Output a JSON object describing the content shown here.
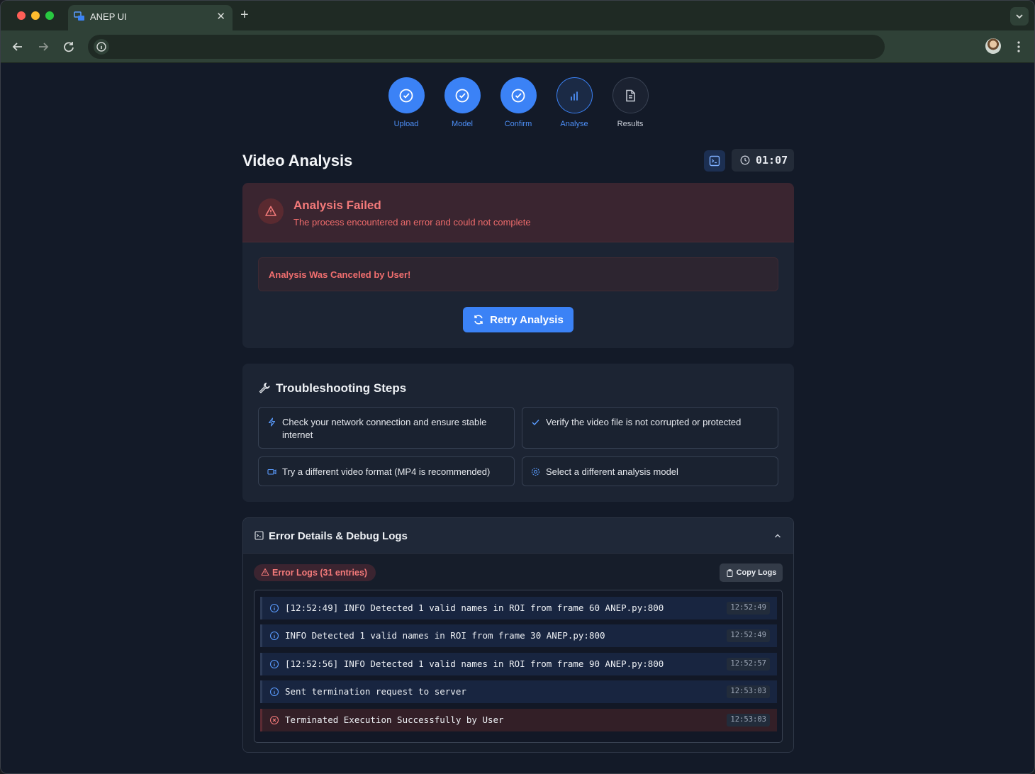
{
  "browser": {
    "tab_title": "ANEP UI",
    "tab_close": "✕",
    "new_tab": "+"
  },
  "stepper": {
    "steps": [
      {
        "label": "Upload",
        "state": "done",
        "icon": "check-circle-icon"
      },
      {
        "label": "Model",
        "state": "done",
        "icon": "check-circle-icon"
      },
      {
        "label": "Confirm",
        "state": "done",
        "icon": "check-circle-icon"
      },
      {
        "label": "Analyse",
        "state": "active",
        "icon": "bar-chart-icon"
      },
      {
        "label": "Results",
        "state": "pending",
        "icon": "document-icon"
      }
    ]
  },
  "header": {
    "title": "Video Analysis",
    "timer": "01:07"
  },
  "failure": {
    "title": "Analysis Failed",
    "subtitle": "The process encountered an error and could not complete",
    "message": "Analysis Was Canceled by User!",
    "retry_label": "Retry Analysis"
  },
  "troubleshooting": {
    "title": "Troubleshooting Steps",
    "items": [
      {
        "text": "Check your network connection and ensure stable internet",
        "icon": "lightning-icon"
      },
      {
        "text": "Verify the video file is not corrupted or protected",
        "icon": "check-icon"
      },
      {
        "text": "Try a different video format (MP4 is recommended)",
        "icon": "video-icon"
      },
      {
        "text": "Select a different analysis model",
        "icon": "settings-icon"
      }
    ]
  },
  "logs": {
    "title": "Error Details & Debug Logs",
    "badge": "Error Logs (31 entries)",
    "copy_label": "Copy Logs",
    "entries": [
      {
        "level": "info",
        "text": "[12:52:49] INFO Detected 1 valid names in ROI from frame 60 ANEP.py:800",
        "time": "12:52:49"
      },
      {
        "level": "info",
        "text": "INFO Detected 1 valid names in ROI from frame 30 ANEP.py:800",
        "time": "12:52:49"
      },
      {
        "level": "info",
        "text": "[12:52:56] INFO Detected 1 valid names in ROI from frame 90 ANEP.py:800",
        "time": "12:52:57"
      },
      {
        "level": "info",
        "text": "Sent termination request to server",
        "time": "12:53:03"
      },
      {
        "level": "error",
        "text": "Terminated Execution Successfully by User",
        "time": "12:53:03"
      }
    ]
  },
  "colors": {
    "accent": "#3b82f6",
    "error": "#f47a7a",
    "background": "#131a28"
  }
}
